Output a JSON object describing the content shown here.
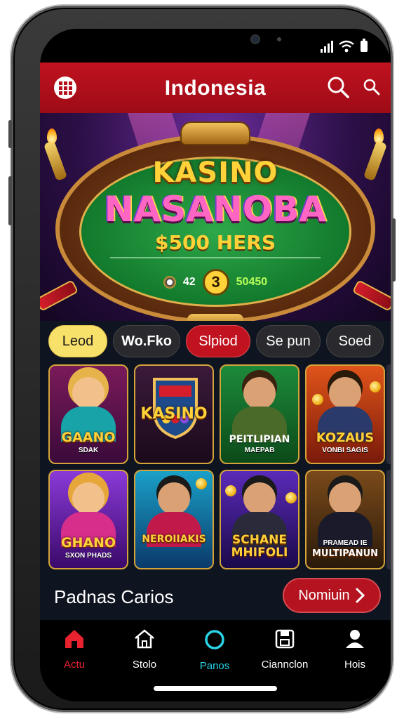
{
  "header": {
    "title": "Indonesia",
    "menu_icon": "grid-menu-icon",
    "search_icon": "search-icon",
    "search_icon_small": "search-icon"
  },
  "hero": {
    "title_line1": "KASINO",
    "title_line2": "NASANOBA",
    "prize": "$500 HERS",
    "chip_left": "42",
    "chip_center": "3",
    "chip_right": "50450"
  },
  "tabs": [
    {
      "label": "Leod",
      "state": "active-yellow"
    },
    {
      "label": "Wo.Fko",
      "state": "bold"
    },
    {
      "label": "Slpiod",
      "state": "active-red"
    },
    {
      "label": "Se pun",
      "state": "default"
    },
    {
      "label": "Soed",
      "state": "default"
    }
  ],
  "games": [
    {
      "title": "GAANO",
      "subtitle": "SDAK"
    },
    {
      "title": "KASINO",
      "subtitle": ""
    },
    {
      "title": "PEITLIPIAN",
      "subtitle": "MAEPAB"
    },
    {
      "title": "KOZAUS",
      "subtitle": "VONBI SAGIS"
    },
    {
      "title": "GHANO",
      "subtitle": "SXON PHADS"
    },
    {
      "title": "NEROIIAKIS",
      "subtitle": ""
    },
    {
      "title": "SCHANE MHIFOLI",
      "subtitle": ""
    },
    {
      "title": "MULTIPANUN",
      "subtitle": "PRAMEAD IE"
    }
  ],
  "section": {
    "title": "Padnas Carios",
    "button_label": "Nomiuin"
  },
  "bottom_nav": [
    {
      "label": "Actu",
      "icon": "home-icon",
      "color": "#e8232f"
    },
    {
      "label": "Stolo",
      "icon": "house-outline-icon",
      "color": "#ffffff"
    },
    {
      "label": "Panos",
      "icon": "circle-icon",
      "color": "#2ad3e6"
    },
    {
      "label": "Ciannclon",
      "icon": "save-icon",
      "color": "#ffffff"
    },
    {
      "label": "Hois",
      "icon": "user-icon",
      "color": "#ffffff"
    }
  ],
  "colors": {
    "header_red": "#c1121f",
    "accent_yellow": "#f8e16b",
    "accent_teal": "#2ad3e6",
    "background": "#0f1520"
  }
}
